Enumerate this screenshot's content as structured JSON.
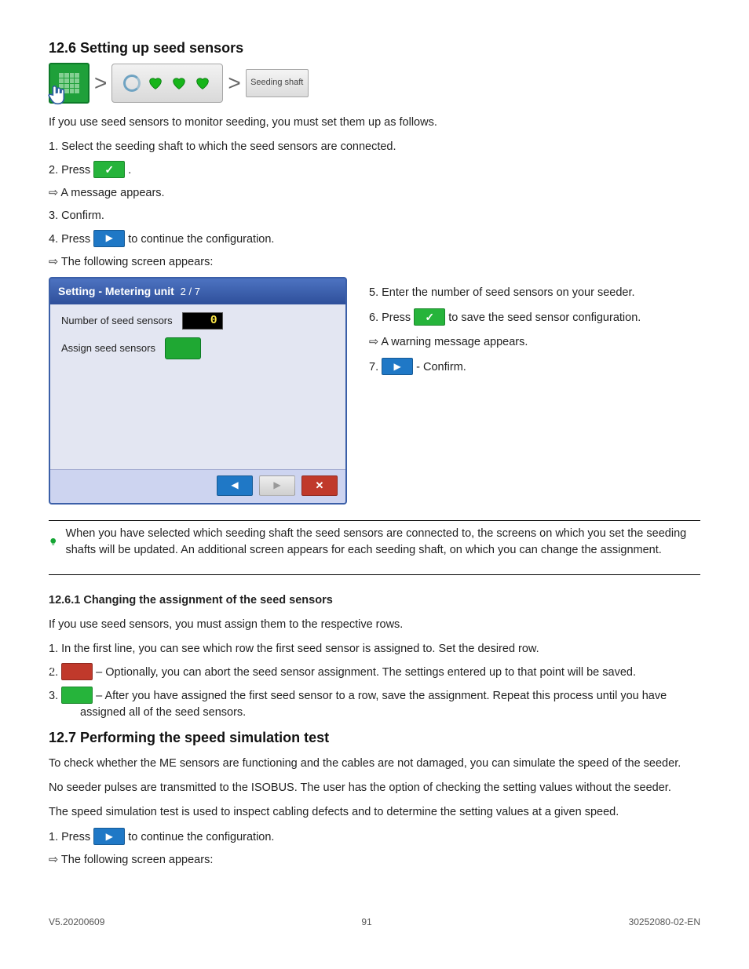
{
  "heading": "12.6 Setting up seed sensors",
  "breadcrumb_end": "Seeding shaft",
  "intro": "If you use seed sensors to monitor seeding, you must set them up as follows.",
  "steps_top": {
    "s1": "1. Select the seeding shaft to which the seed sensors are connected.",
    "s2_a": "2. Press ",
    "s2_b": ".",
    "s3": "⇨ A message appears.",
    "s3b": "3. Confirm.",
    "s4_a": "4. Press ",
    "s4_b": " to continue the configuration.",
    "s5": "⇨ The following screen appears:"
  },
  "dialog": {
    "title": "Setting - Metering unit",
    "title_num": "2 / 7",
    "label_sensors": "Number of seed sensors",
    "count": "0",
    "label_assign": "Assign seed sensors"
  },
  "right_steps": {
    "r5": "5. Enter the number of seed sensors on your seeder.",
    "r6_a": "6. Press ",
    "r6_b": " to save the seed sensor configuration.",
    "r6c": "⇨ A warning message appears.",
    "r7_a": "7. ",
    "r7_b": " - Confirm."
  },
  "tip_text": "When you have selected which seeding shaft the seed sensors are connected to, the screens on which you set the seeding shafts will be updated. An additional screen appears for each seeding shaft, on which you can change the assignment.",
  "assign_heading": "12.6.1 Changing the assignment of the seed sensors",
  "assign_intro": "If you use seed sensors, you must assign them to the respective rows.",
  "assign_s1": "1. In the first line, you can see which row the first seed sensor is assigned to. Set the desired row.",
  "assign_s2a": "2. ",
  "assign_s2b": " – Optionally, you can abort the seed sensor assignment. The settings entered up to that point will be saved.",
  "assign_s3a": "3. ",
  "assign_s3b": " – After you have assigned the first seed sensor to a row, save the assignment. Repeat this process until you have assigned all of the seed sensors.",
  "test_heading": "12.7 Performing the speed simulation test",
  "test_intro": "To check whether the ME sensors are functioning and the cables are not damaged, you can simulate the speed of the seeder.",
  "test_note_a": "No seeder pulses are transmitted to the ISOBUS. The user has the option of checking the setting values without the seeder.",
  "test_note_b": "The speed simulation test is used to inspect cabling defects and to determine the setting values at a given speed.",
  "test_s1": "1. Press ",
  "test_s1b": " to continue the configuration.",
  "test_s1c": "⇨ The following screen appears:",
  "footer": {
    "left": "V5.20200609",
    "center": "91",
    "right": "30252080-02-EN"
  }
}
